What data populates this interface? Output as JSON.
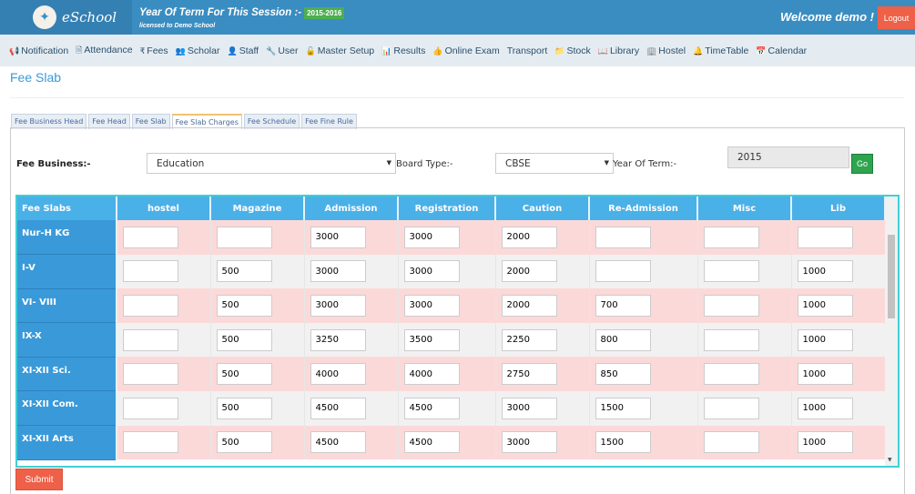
{
  "header": {
    "logo": "eSchool",
    "session_label": "Year Of Term For This Session :-",
    "session_value": "2015-2016",
    "licensed": "licensed to Demo School",
    "welcome": "Welcome demo !",
    "logout": "Logout"
  },
  "nav": [
    {
      "icon": "📢",
      "label": "Notification"
    },
    {
      "icon": "🗎",
      "label": "Attendance"
    },
    {
      "icon": "₹",
      "label": "Fees"
    },
    {
      "icon": "👥",
      "label": "Scholar"
    },
    {
      "icon": "👤",
      "label": "Staff"
    },
    {
      "icon": "🔧",
      "label": "User"
    },
    {
      "icon": "🔓",
      "label": "Master Setup"
    },
    {
      "icon": "📊",
      "label": "Results"
    },
    {
      "icon": "👍",
      "label": "Online Exam"
    },
    {
      "icon": "",
      "label": "Transport"
    },
    {
      "icon": "📁",
      "label": "Stock"
    },
    {
      "icon": "📖",
      "label": "Library"
    },
    {
      "icon": "🏢",
      "label": "Hostel"
    },
    {
      "icon": "🔔",
      "label": "TimeTable"
    },
    {
      "icon": "📅",
      "label": "Calendar"
    }
  ],
  "page_title": "Fee Slab",
  "tabs": [
    "Fee Business Head",
    "Fee Head",
    "Fee Slab",
    "Fee Slab Charges",
    "Fee Schedule",
    "Fee Fine Rule"
  ],
  "filters": {
    "fee_business_label": "Fee Business:-",
    "fee_business_value": "Education",
    "board_type_label": "Board Type:-",
    "board_type_value": "CBSE",
    "year_label": "Year Of Term:-",
    "year_value": "2015",
    "go": "Go"
  },
  "table": {
    "headers": [
      "Fee Slabs",
      "hostel",
      "Magazine",
      "Admission",
      "Registration",
      "Caution",
      "Re-Admission",
      "Misc",
      "Lib"
    ],
    "rows": [
      {
        "slab": "Nur-H KG",
        "values": [
          "",
          "",
          "3000",
          "3000",
          "2000",
          "",
          "",
          ""
        ]
      },
      {
        "slab": "I-V",
        "values": [
          "",
          "500",
          "3000",
          "3000",
          "2000",
          "",
          "",
          "1000"
        ]
      },
      {
        "slab": "VI- VIII",
        "values": [
          "",
          "500",
          "3000",
          "3000",
          "2000",
          "700",
          "",
          "1000"
        ]
      },
      {
        "slab": "IX-X",
        "values": [
          "",
          "500",
          "3250",
          "3500",
          "2250",
          "800",
          "",
          "1000"
        ]
      },
      {
        "slab": "XI-XII Sci.",
        "values": [
          "",
          "500",
          "4000",
          "4000",
          "2750",
          "850",
          "",
          "1000"
        ]
      },
      {
        "slab": "XI-XII Com.",
        "values": [
          "",
          "500",
          "4500",
          "4500",
          "3000",
          "1500",
          "",
          "1000"
        ]
      },
      {
        "slab": "XI-XII Arts",
        "values": [
          "",
          "500",
          "4500",
          "4500",
          "3000",
          "1500",
          "",
          "1000"
        ]
      }
    ]
  },
  "submit": "Submit"
}
